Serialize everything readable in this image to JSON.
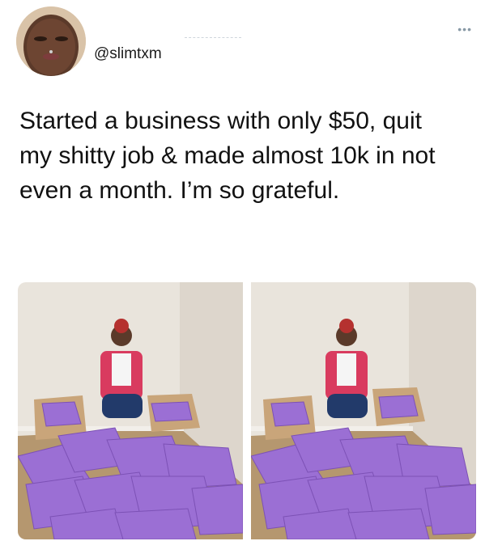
{
  "tweet": {
    "handle": "@slimtxm",
    "text": "Started a business with only $50, quit my shitty job & made almost 10k in not even a month. I’m so grateful.",
    "more_icon": "more-dots-icon"
  },
  "media": {
    "photos": [
      {
        "description_name": "photo-left"
      },
      {
        "description_name": "photo-right"
      }
    ]
  },
  "colors": {
    "package_purple": "#9b6fd4",
    "wall": "#ece7e0",
    "floor": "#b89b74"
  }
}
